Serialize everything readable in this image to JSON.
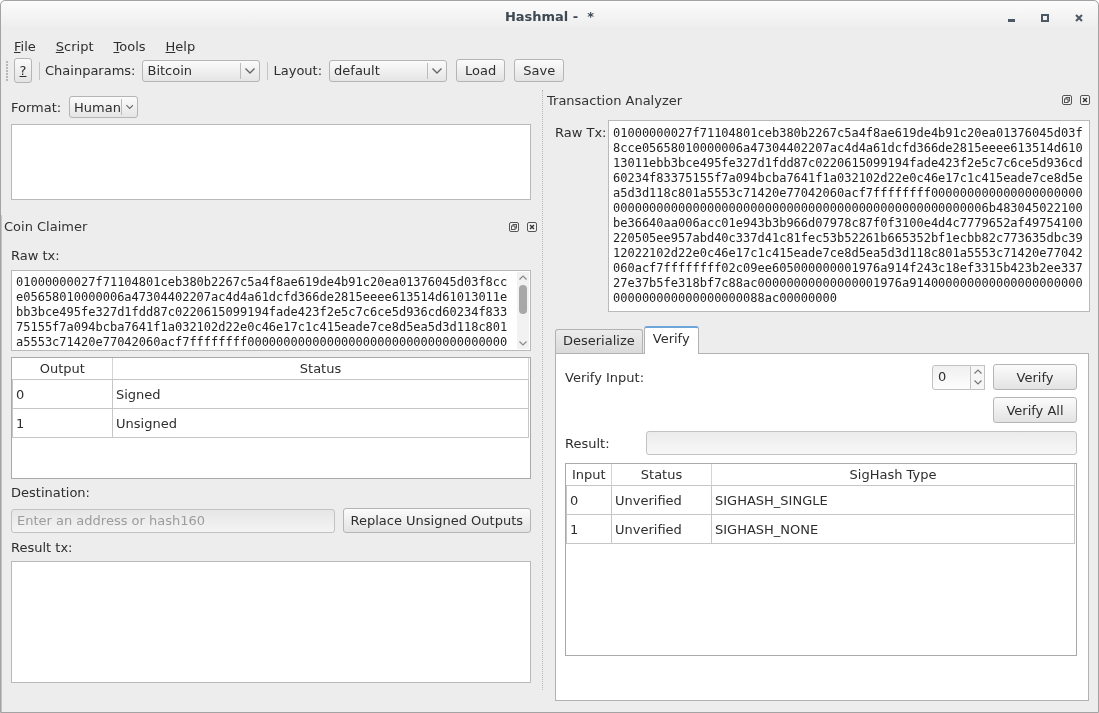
{
  "window": {
    "title": "Hashmal -  *"
  },
  "menu": [
    "File",
    "Script",
    "Tools",
    "Help"
  ],
  "toolbar": {
    "help_button": "?",
    "chainparams_label": "Chainparams:",
    "chainparams_value": "Bitcoin",
    "layout_label": "Layout:",
    "layout_value": "default",
    "buttons": [
      "Load",
      "Save"
    ]
  },
  "format": {
    "label": "Format:",
    "value": "Human"
  },
  "coin_claimer": {
    "title": "Coin Claimer",
    "raw_tx_label": "Raw tx:",
    "raw_tx": "01000000027f71104801ceb380b2267c5a4f8ae619de4b91c20ea01376045d03f8cce05658010000006a47304402207ac4d4a61dcfd366de2815eeee613514d61013011ebb3bce495fe327d1fdd87c0220615099194fade423f2e5c7c6ce5d936cd60234f83375155f7a094bcba7641f1a032102d22e0c46e17c1c415eade7ce8d5ea5d3d118c801a5553c71420e77042060acf7ffffffff000000000000000000000000000000000000",
    "table": {
      "columns": [
        "Output",
        "Status"
      ],
      "rows": [
        [
          "0",
          "Signed"
        ],
        [
          "1",
          "Unsigned"
        ]
      ]
    },
    "destination_label": "Destination:",
    "destination": {
      "placeholder": "Enter an address or hash160"
    },
    "replace_button": "Replace Unsigned Outputs",
    "result_label": "Result tx:"
  },
  "transaction_analyzer": {
    "title": "Transaction Analyzer",
    "raw_tx_label": "Raw Tx:",
    "raw_tx": "01000000027f71104801ceb380b2267c5a4f8ae619de4b91c20ea01376045d03f8cce05658010000006a47304402207ac4d4a61dcfd366de2815eeee613514d61013011ebb3bce495fe327d1fdd87c0220615099194fade423f2e5c7c6ce5d936cd60234f83375155f7a094bcba7641f1a032102d22e0c46e17c1c415eade7ce8d5ea5d3d118c801a5553c71420e77042060acf7ffffffff0000000000000000000000000000000000000000000000000000000000000000000000006b483045022100be36640aa006acc01e943b3b966d07978c87f0f3100e4d4c7779652af49754100220505ee957abd40c337d41c81fec53b52261b665352bf1ecbb82c773635dbc3912022102d22e0c46e17c1c415eade7ce8d5ea5d3d118c801a5553c71420e77042060acf7ffffffff02c09ee605000000001976a914f243c18ef3315b423b2ee33727e37b5fe318bf7c88ac00000000000000001976a914000000000000000000000000000000000000000088ac00000000",
    "tabs": [
      {
        "label": "Deserialize",
        "selected": false
      },
      {
        "label": "Verify",
        "selected": true
      }
    ],
    "verify": {
      "input_label": "Verify Input:",
      "input_value": "0",
      "buttons": [
        "Verify",
        "Verify All"
      ],
      "result_label": "Result:",
      "table": {
        "columns": [
          "Input",
          "Status",
          "SigHash Type"
        ],
        "rows": [
          [
            "0",
            "Unverified",
            "SIGHASH_SINGLE"
          ],
          [
            "1",
            "Unverified",
            "SIGHASH_NONE"
          ]
        ]
      }
    }
  }
}
